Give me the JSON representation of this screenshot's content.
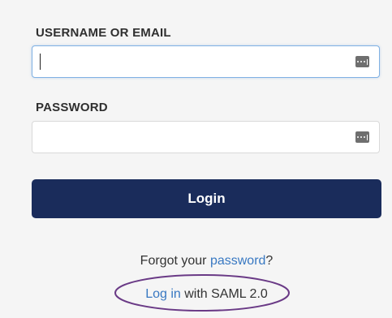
{
  "form": {
    "username": {
      "label": "USERNAME OR EMAIL",
      "value": "",
      "placeholder": ""
    },
    "password": {
      "label": "PASSWORD",
      "value": "",
      "placeholder": ""
    },
    "login_button": "Login",
    "forgot": {
      "prefix": "Forgot your ",
      "link": "password",
      "suffix": "?"
    },
    "saml": {
      "link": "Log in",
      "suffix": " with SAML 2.0"
    }
  },
  "icons": {
    "password_manager": "password-manager-icon"
  },
  "colors": {
    "accent_button": "#1a2c5b",
    "link": "#3878c2",
    "annotation_ellipse": "#6a3a86",
    "focused_border": "#7fb1e3"
  }
}
